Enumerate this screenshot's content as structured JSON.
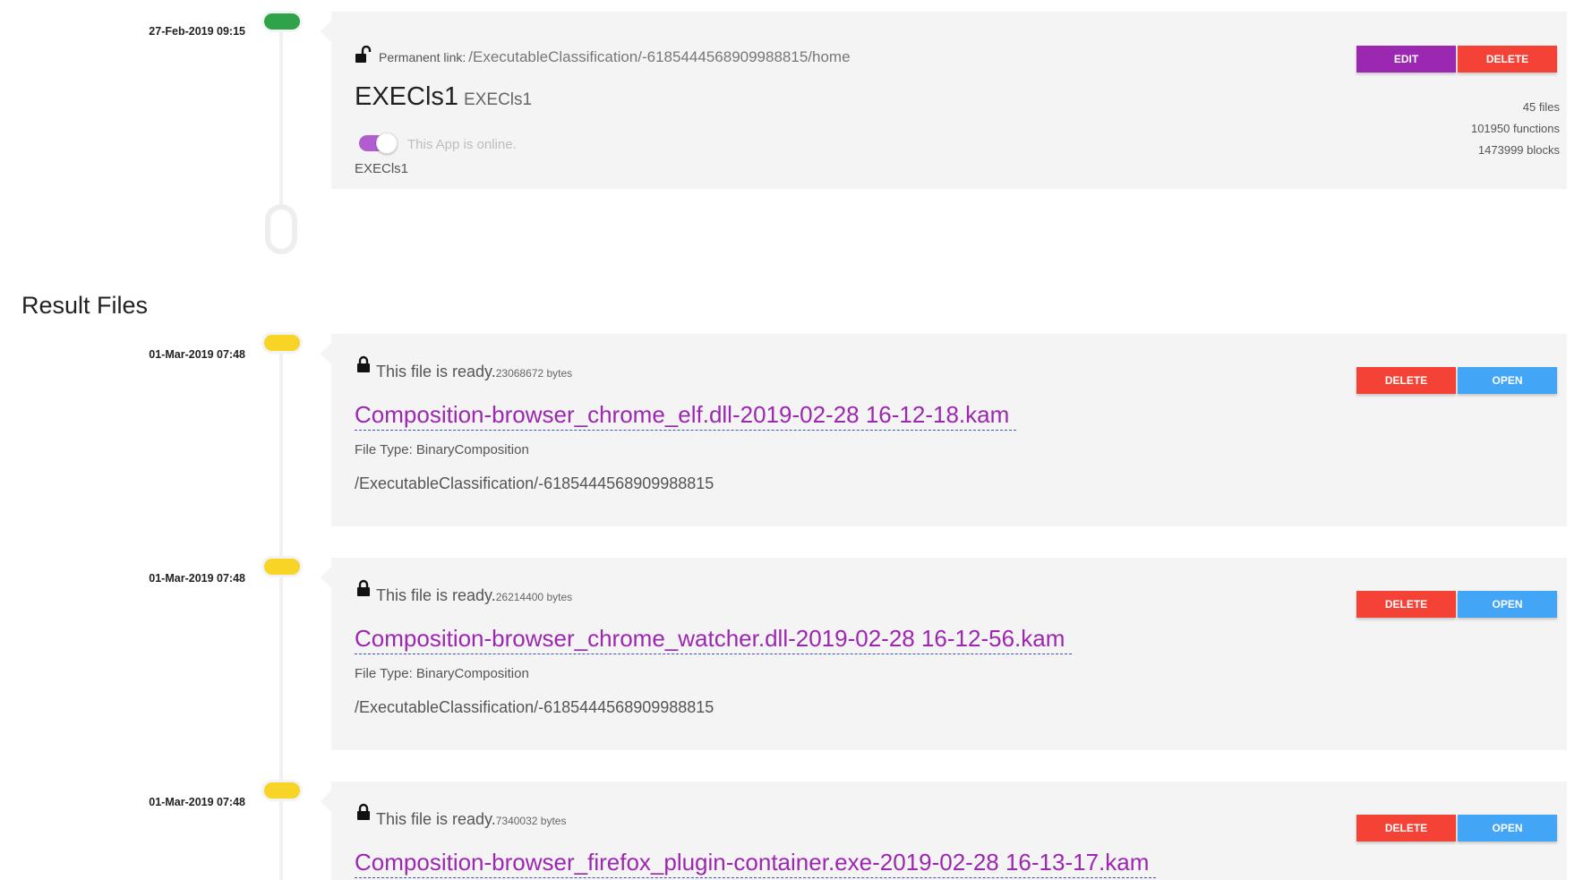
{
  "app_entry": {
    "date": "27-Feb-2019 09:15",
    "permanent_link_label": "Permanent link:",
    "permanent_link_path": "/ExecutableClassification/-6185444568909988815/home",
    "name": "EXECls1",
    "subname": "EXECls1",
    "online_text": "This App is online.",
    "description": "EXECls1",
    "stats": {
      "files": "45 files",
      "functions": "101950 functions",
      "blocks": "1473999 blocks"
    },
    "edit_label": "EDIT",
    "delete_label": "DELETE",
    "status_color": "#2fa34a",
    "toggle_on": true
  },
  "result_files_heading": "Result Files",
  "files": [
    {
      "date": "01-Mar-2019 07:48",
      "status_text": "This file is ready.",
      "size": "23068672 bytes",
      "name": "Composition-browser_chrome_elf.dll-2019-02-28 16-12-18.kam",
      "type_line": "File Type: BinaryComposition",
      "path": "/ExecutableClassification/-6185444568909988815",
      "delete_label": "DELETE",
      "open_label": "OPEN"
    },
    {
      "date": "01-Mar-2019 07:48",
      "status_text": "This file is ready.",
      "size": "26214400 bytes",
      "name": "Composition-browser_chrome_watcher.dll-2019-02-28 16-12-56.kam",
      "type_line": "File Type: BinaryComposition",
      "path": "/ExecutableClassification/-6185444568909988815",
      "delete_label": "DELETE",
      "open_label": "OPEN"
    },
    {
      "date": "01-Mar-2019 07:48",
      "status_text": "This file is ready.",
      "size": "7340032 bytes",
      "name": "Composition-browser_firefox_plugin-container.exe-2019-02-28 16-13-17.kam",
      "delete_label": "DELETE",
      "open_label": "OPEN"
    }
  ],
  "colors": {
    "ready_marker": "#f7d426",
    "accent": "#9c27b0",
    "delete": "#f44336",
    "open": "#42a5f5"
  }
}
